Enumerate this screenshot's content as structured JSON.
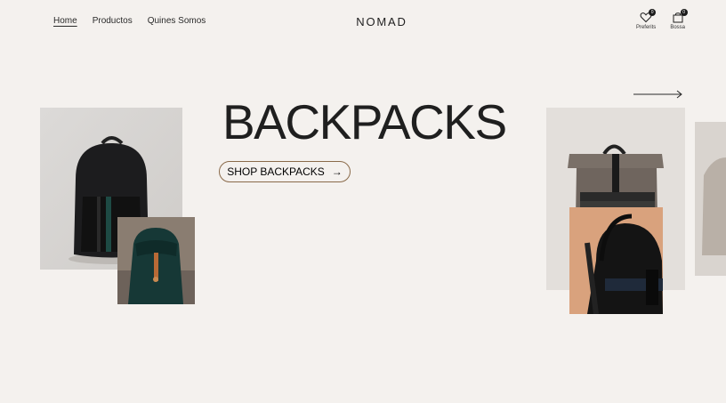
{
  "nav": {
    "items": [
      {
        "label": "Home"
      },
      {
        "label": "Productos"
      },
      {
        "label": "Quines Somos"
      }
    ]
  },
  "brand": "NOMAD",
  "utility": {
    "favorites": {
      "label": "Preferits",
      "count": "0",
      "icon": "heart-icon"
    },
    "bag": {
      "label": "Bossa",
      "count": "0",
      "icon": "bag-icon"
    }
  },
  "hero": {
    "title": "BACKPACKS",
    "cta_label": "SHOP BACKPACKS",
    "cta_icon": "arrow-right-icon",
    "next_icon": "long-arrow-right-icon"
  },
  "images": [
    {
      "name": "black-leather-backpack",
      "bg": "#dad8d6"
    },
    {
      "name": "green-drawstring-backpack",
      "bg": "#86796d"
    },
    {
      "name": "olive-rolltop-backpack",
      "bg": "#e2deda"
    },
    {
      "name": "black-backpack-closeup",
      "bg": "#d9a37f"
    },
    {
      "name": "partial-backpack",
      "bg": "#d8d3ce"
    }
  ]
}
